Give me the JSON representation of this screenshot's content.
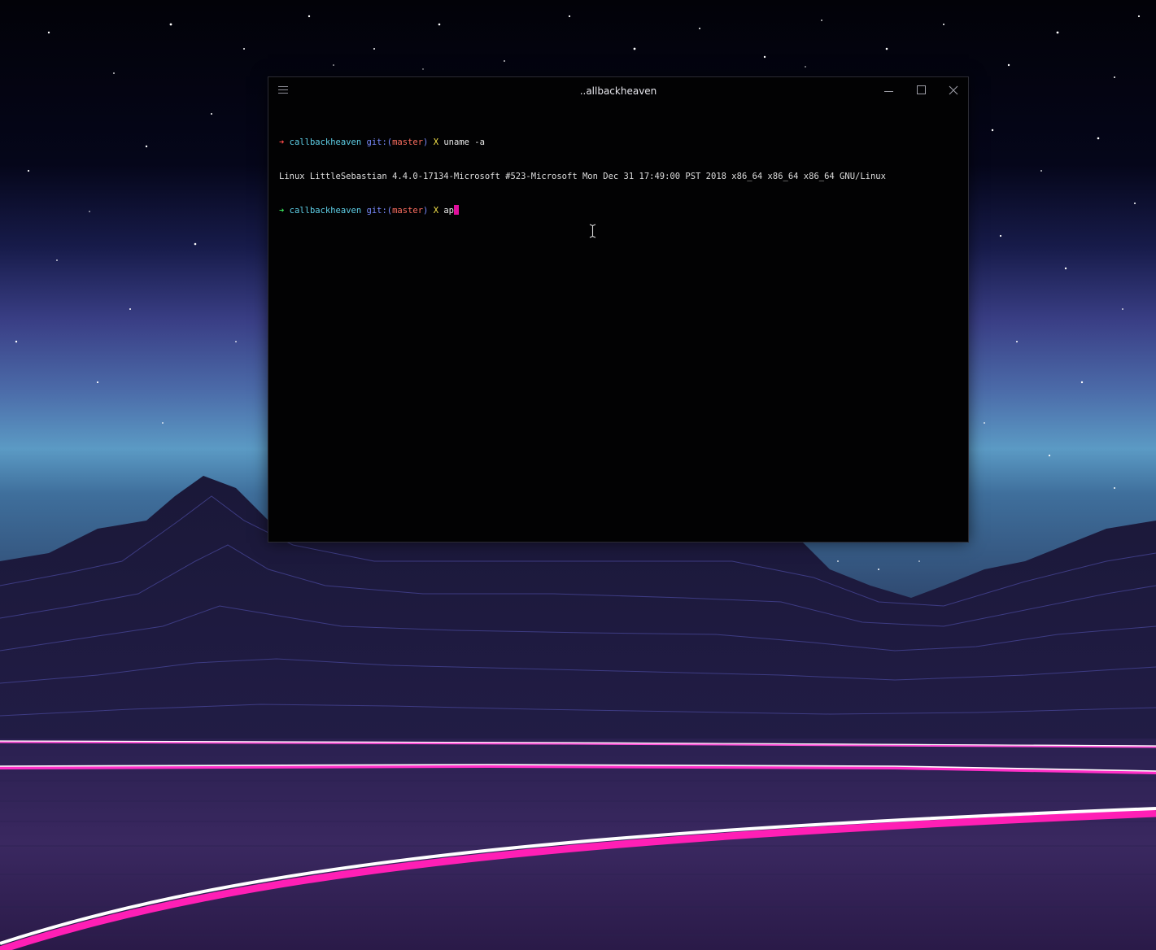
{
  "window": {
    "title": "..allbackheaven"
  },
  "terminal": {
    "lines": [
      {
        "arrow": "➜",
        "dir": "callbackheaven",
        "git_prefix": "git:(",
        "branch": "master",
        "git_suffix": ")",
        "dirty": "X",
        "command": "uname -a"
      },
      {
        "output": "Linux LittleSebastian 4.4.0-17134-Microsoft #523-Microsoft Mon Dec 31 17:49:00 PST 2018 x86_64 x86_64 x86_64 GNU/Linux"
      },
      {
        "arrow": "➜",
        "dir": "callbackheaven",
        "git_prefix": "git:(",
        "branch": "master",
        "git_suffix": ")",
        "dirty": "X",
        "command": "ap"
      }
    ]
  },
  "colors": {
    "prompt_arrow_error": "#ff4a4a",
    "prompt_arrow_ok": "#39e05a",
    "directory": "#5fd0e8",
    "git_label": "#7a8cff",
    "branch": "#ff6f61",
    "dirty_marker": "#f4e24a",
    "cursor": "#e0109d"
  },
  "icons": {
    "menu": "hamburger-icon",
    "minimize": "minimize-icon",
    "maximize": "maximize-icon",
    "close": "close-icon",
    "mouse_cursor": "text-ibeam-icon"
  }
}
